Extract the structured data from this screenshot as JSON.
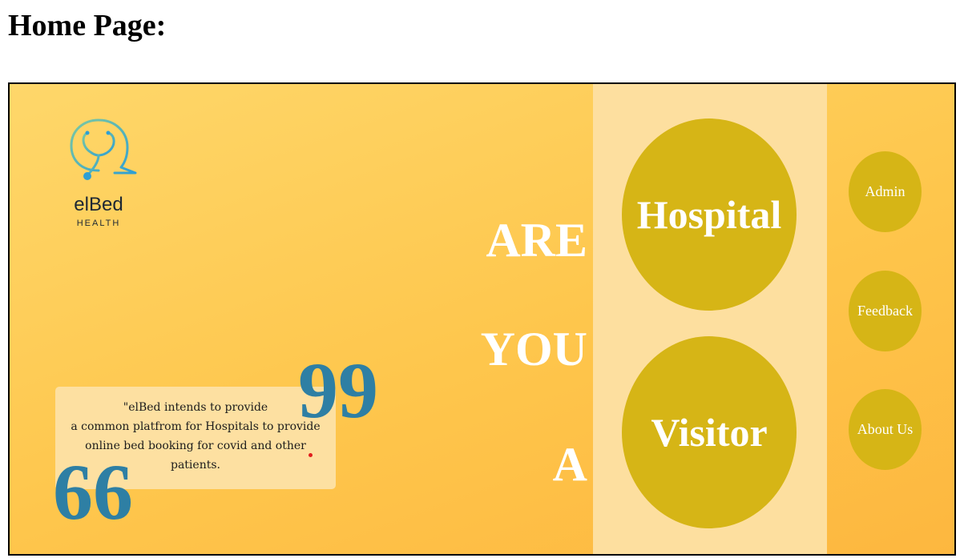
{
  "page_heading": "Home Page:",
  "logo": {
    "name": "elBed",
    "subtitle": "HEALTH",
    "icon": "stethoscope-chat-icon",
    "colors": {
      "gradient_start": "#7dc8a0",
      "gradient_end": "#2e9fd4"
    }
  },
  "quote": {
    "lines": [
      "\"elBed intends to provide",
      "a common platfrom for Hospitals to provide",
      "online bed booking for covid and other",
      "patients."
    ],
    "open_mark": "66",
    "close_mark": "99",
    "mark_color": "#2e7fa4"
  },
  "question_words": [
    "ARE",
    "YOU",
    "A"
  ],
  "roles": {
    "hospital_label": "Hospital",
    "visitor_label": "Visitor"
  },
  "nav": {
    "admin_label": "Admin",
    "feedback_label": "Feedback",
    "about_label": "About Us"
  },
  "colors": {
    "background_start": "#fed76a",
    "background_end": "#fdb73f",
    "stripe": "#fddf9f",
    "circle": "#d6b516",
    "quote_card": "#fde0a1"
  }
}
